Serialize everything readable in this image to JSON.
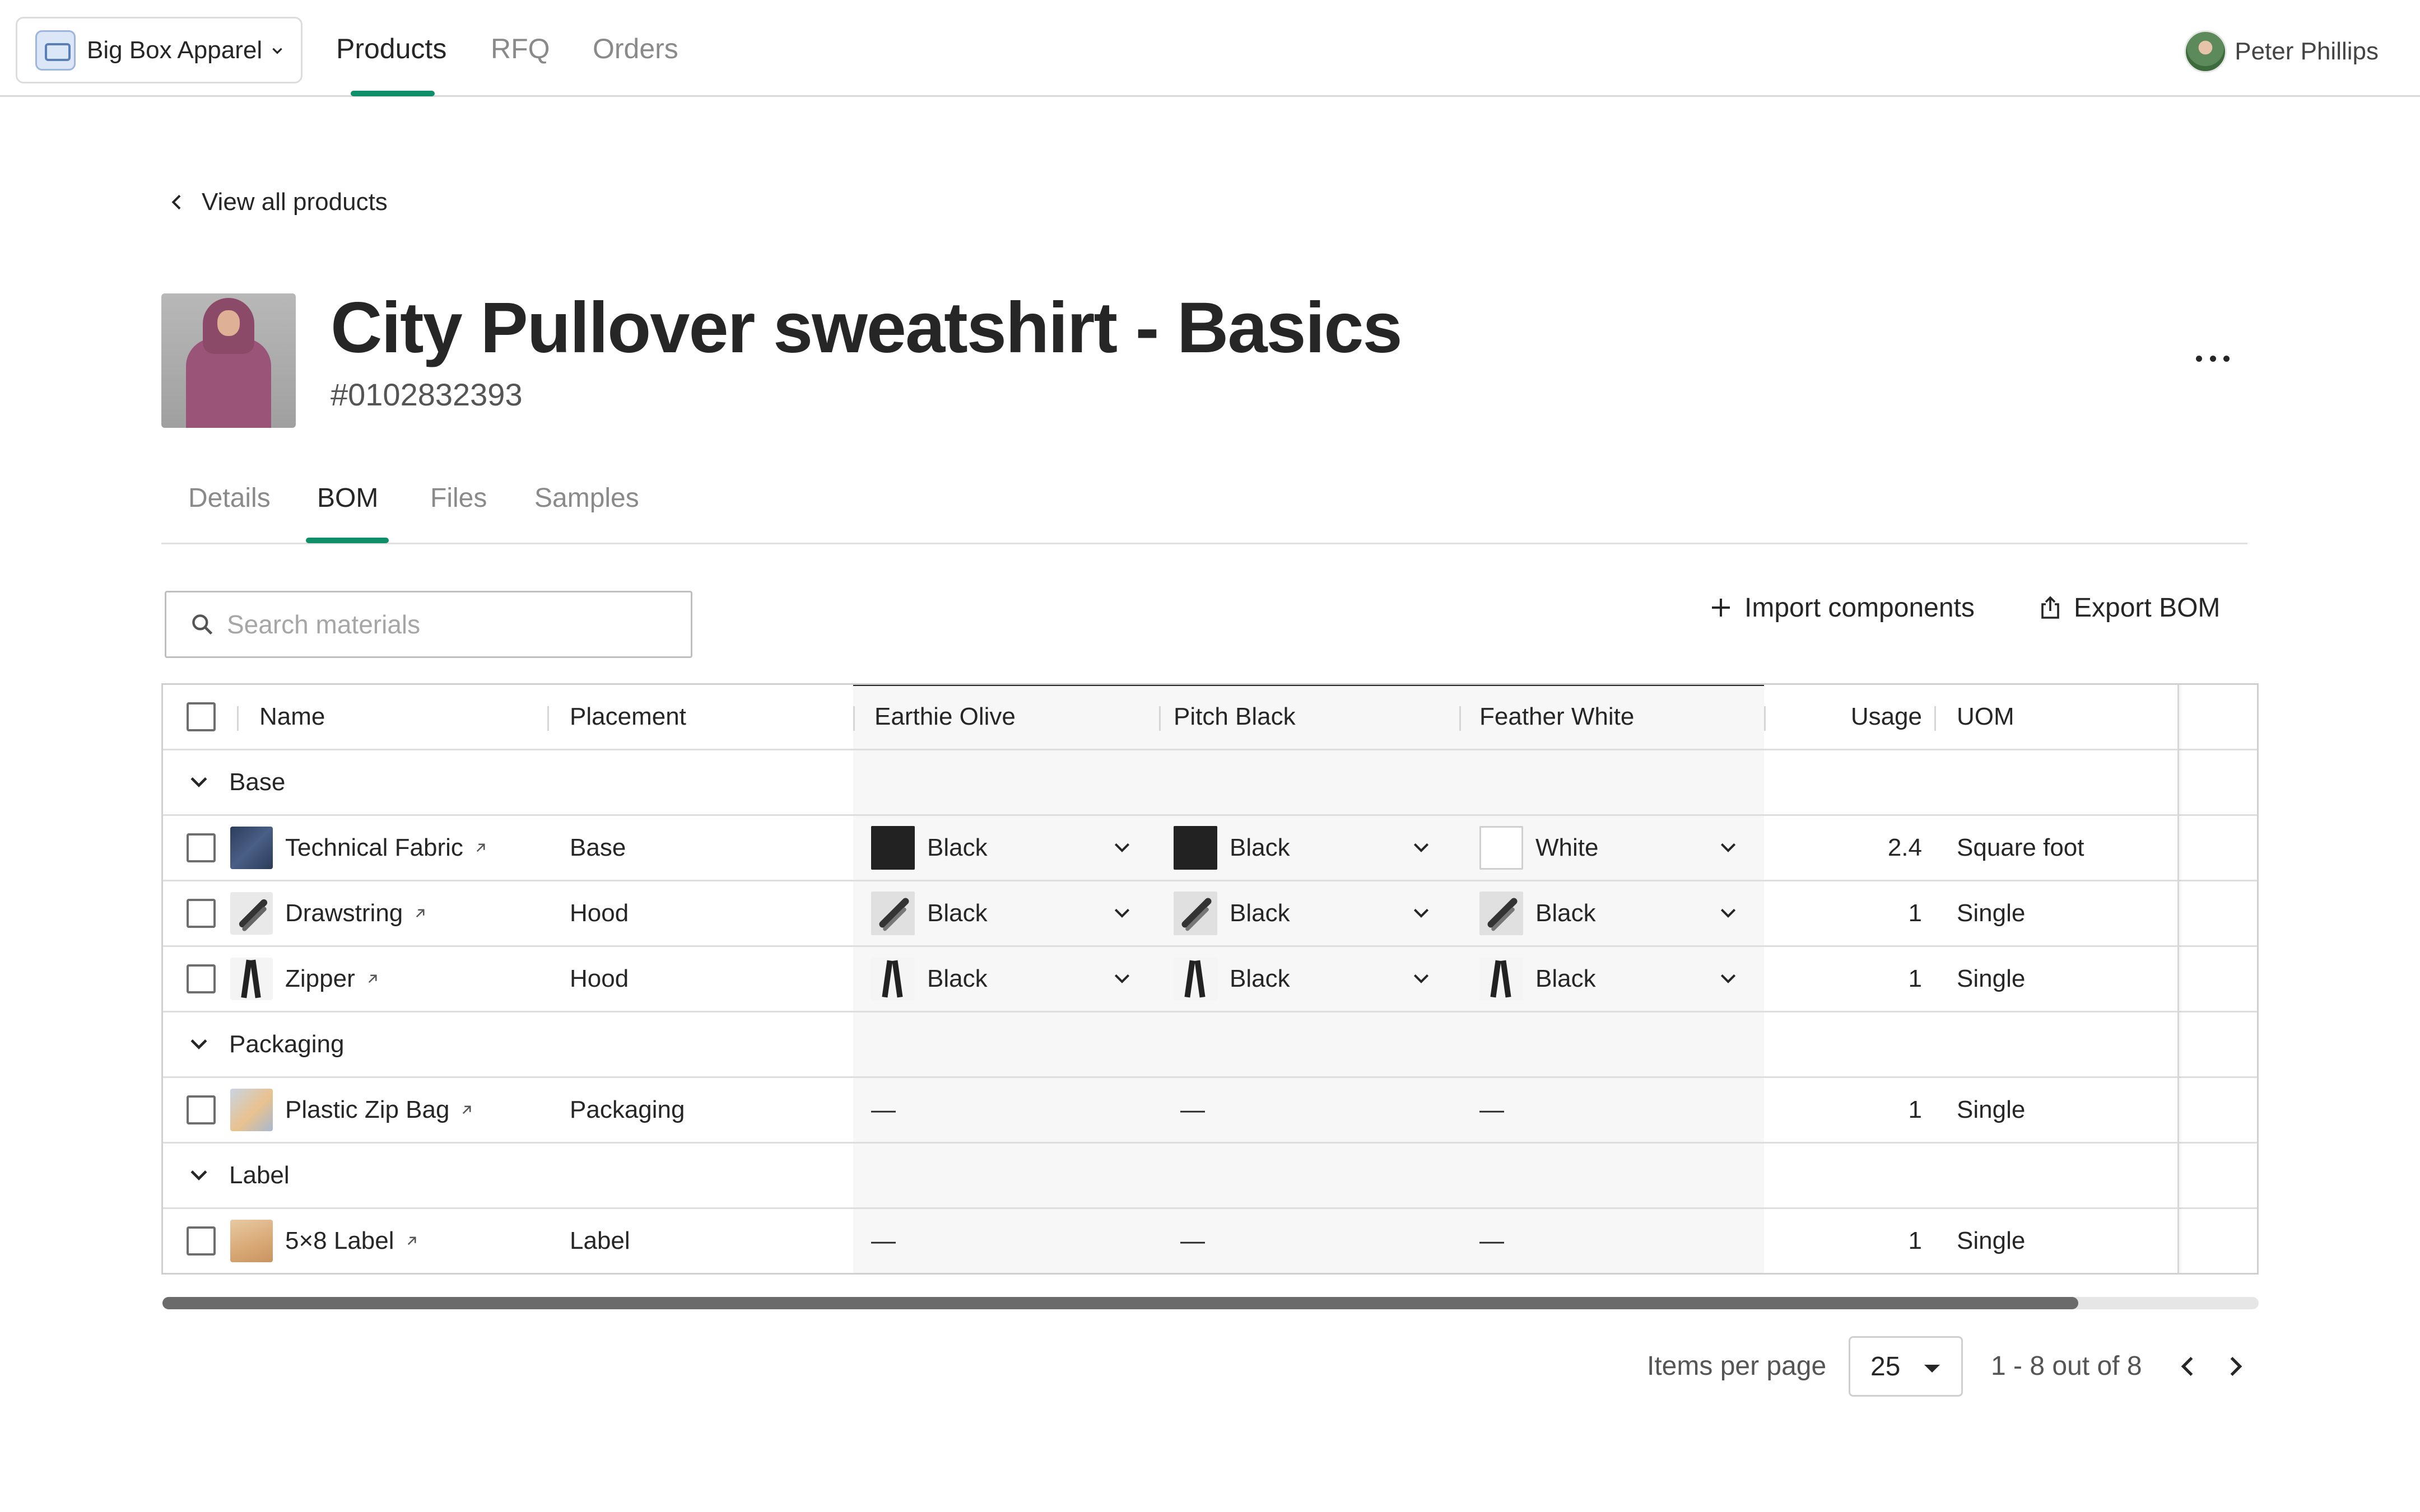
{
  "topnav": {
    "org_name": "Big Box Apparel",
    "tabs": [
      {
        "label": "Products",
        "active": true
      },
      {
        "label": "RFQ",
        "active": false
      },
      {
        "label": "Orders",
        "active": false
      }
    ],
    "user_name": "Peter Phillips",
    "accent_color": "#0e8f6a"
  },
  "breadcrumb": {
    "back_label": "View all products"
  },
  "product": {
    "title": "City Pullover sweatshirt - Basics",
    "id": "#0102832393"
  },
  "subtabs": [
    {
      "label": "Details",
      "active": false
    },
    {
      "label": "BOM",
      "active": true
    },
    {
      "label": "Files",
      "active": false
    },
    {
      "label": "Samples",
      "active": false
    }
  ],
  "toolbar": {
    "search_placeholder": "Search materials",
    "search_value": "",
    "import_label": "Import components",
    "export_label": "Export BOM"
  },
  "table": {
    "columns": {
      "name": "Name",
      "placement": "Placement",
      "colorways": [
        "Earthie Olive",
        "Pitch Black",
        "Feather White"
      ],
      "usage": "Usage",
      "uom": "UOM"
    },
    "groups": [
      {
        "label": "Base",
        "rows": [
          {
            "name": "Technical Fabric",
            "thumb": "fabric",
            "placement": "Base",
            "colors": [
              {
                "value": "Black",
                "swatch": "black"
              },
              {
                "value": "Black",
                "swatch": "black"
              },
              {
                "value": "White",
                "swatch": "white"
              }
            ],
            "usage": "2.4",
            "uom": "Square foot"
          },
          {
            "name": "Drawstring",
            "thumb": "drawstring",
            "placement": "Hood",
            "colors": [
              {
                "value": "Black",
                "swatch": "drawstring"
              },
              {
                "value": "Black",
                "swatch": "drawstring"
              },
              {
                "value": "Black",
                "swatch": "drawstring"
              }
            ],
            "usage": "1",
            "uom": "Single"
          },
          {
            "name": "Zipper",
            "thumb": "zipper",
            "placement": "Hood",
            "colors": [
              {
                "value": "Black",
                "swatch": "zipper"
              },
              {
                "value": "Black",
                "swatch": "zipper"
              },
              {
                "value": "Black",
                "swatch": "zipper"
              }
            ],
            "usage": "1",
            "uom": "Single"
          }
        ]
      },
      {
        "label": "Packaging",
        "rows": [
          {
            "name": "Plastic Zip Bag",
            "thumb": "bag",
            "placement": "Packaging",
            "colors": [
              {
                "value": "—"
              },
              {
                "value": "—"
              },
              {
                "value": "—"
              }
            ],
            "usage": "1",
            "uom": "Single"
          }
        ]
      },
      {
        "label": "Label",
        "rows": [
          {
            "name": "5×8 Label",
            "thumb": "label",
            "placement": "Label",
            "colors": [
              {
                "value": "—"
              },
              {
                "value": "—"
              },
              {
                "value": "—"
              }
            ],
            "usage": "1",
            "uom": "Single"
          }
        ]
      }
    ]
  },
  "pagination": {
    "items_per_page_label": "Items per page",
    "items_per_page": "25",
    "range": "1 - 8 out of 8"
  }
}
